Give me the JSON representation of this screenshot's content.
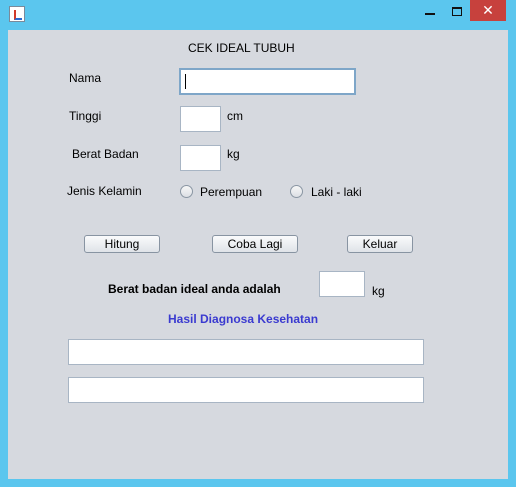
{
  "window": {
    "app_icon": "java-icon",
    "close_glyph": "✕"
  },
  "form": {
    "title": "CEK IDEAL TUBUH",
    "nama_label": "Nama",
    "nama_value": "",
    "tinggi_label": "Tinggi",
    "tinggi_value": "",
    "tinggi_unit": "cm",
    "berat_label": "Berat Badan",
    "berat_value": "",
    "berat_unit": "kg",
    "gender_label": "Jenis Kelamin",
    "gender_options": [
      "Perempuan",
      "Laki - laki"
    ]
  },
  "buttons": {
    "hitung": "Hitung",
    "coba_lagi": "Coba Lagi",
    "keluar": "Keluar"
  },
  "result": {
    "label": "Berat badan ideal anda adalah",
    "value": "",
    "unit": "kg",
    "diagnosis_title": "Hasil Diagnosa Kesehatan",
    "diagnosis_line1": "",
    "diagnosis_line2": ""
  }
}
